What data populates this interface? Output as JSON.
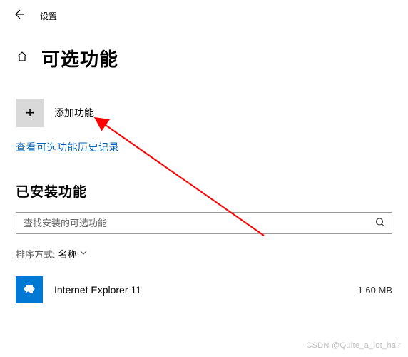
{
  "topbar": {
    "settings_label": "设置"
  },
  "title": {
    "text": "可选功能"
  },
  "add": {
    "label": "添加功能",
    "icon_plus": "+"
  },
  "history_link": "查看可选功能历史记录",
  "installed": {
    "heading": "已安装功能"
  },
  "search": {
    "placeholder": "查找安装的可选功能"
  },
  "sort": {
    "label": "排序方式:",
    "value": "名称"
  },
  "list": {
    "items": [
      {
        "name": "Internet Explorer 11",
        "size": "1.60 MB"
      }
    ]
  },
  "watermark": "CSDN @Quite_a_lot_hair"
}
